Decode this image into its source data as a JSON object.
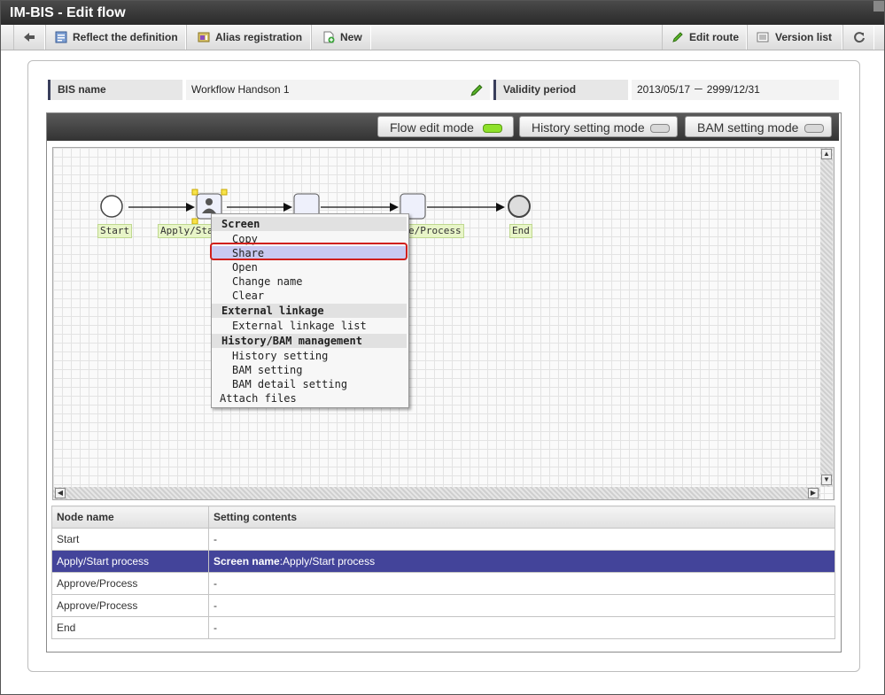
{
  "window": {
    "title": "IM-BIS - Edit flow"
  },
  "toolbar": {
    "back_icon": "arrow-left-icon",
    "reflect": "Reflect the definition",
    "alias": "Alias registration",
    "new": "New",
    "edit_route": "Edit route",
    "version_list": "Version list",
    "refresh_icon": "refresh-icon"
  },
  "info": {
    "bis_name_label": "BIS name",
    "bis_name_value": "Workflow Handson 1",
    "validity_label": "Validity period",
    "validity_value": "2013/05/17 － 2999/12/31"
  },
  "modes": {
    "flow_edit": {
      "label": "Flow edit mode",
      "active": true
    },
    "history": {
      "label": "History setting mode",
      "active": false
    },
    "bam": {
      "label": "BAM setting mode",
      "active": false
    }
  },
  "flow": {
    "nodes": {
      "start": "Start",
      "apply": "Apply/Start",
      "approve2": "e/Process",
      "end": "End"
    }
  },
  "context_menu": {
    "screen_header": "Screen",
    "copy": "Copy",
    "share": "Share",
    "open": "Open",
    "change_name": "Change name",
    "clear": "Clear",
    "external_header": "External linkage",
    "external_list": "External linkage list",
    "history_header": "History/BAM management",
    "history_setting": "History setting",
    "bam_setting": "BAM setting",
    "bam_detail": "BAM detail setting",
    "attach": "Attach files"
  },
  "table": {
    "headers": [
      "Node name",
      "Setting contents"
    ],
    "rows": [
      {
        "name": "Start",
        "content_label": "",
        "content": "-"
      },
      {
        "name": "Apply/Start process",
        "content_label": "Screen name",
        "content": ":Apply/Start process"
      },
      {
        "name": "Approve/Process",
        "content_label": "",
        "content": "-"
      },
      {
        "name": "Approve/Process",
        "content_label": "",
        "content": "-"
      },
      {
        "name": "End",
        "content_label": "",
        "content": "-"
      }
    ]
  },
  "colors": {
    "accent_selection": "#43449a",
    "active_led": "#8ee12a",
    "highlight_border": "#d0201b"
  }
}
